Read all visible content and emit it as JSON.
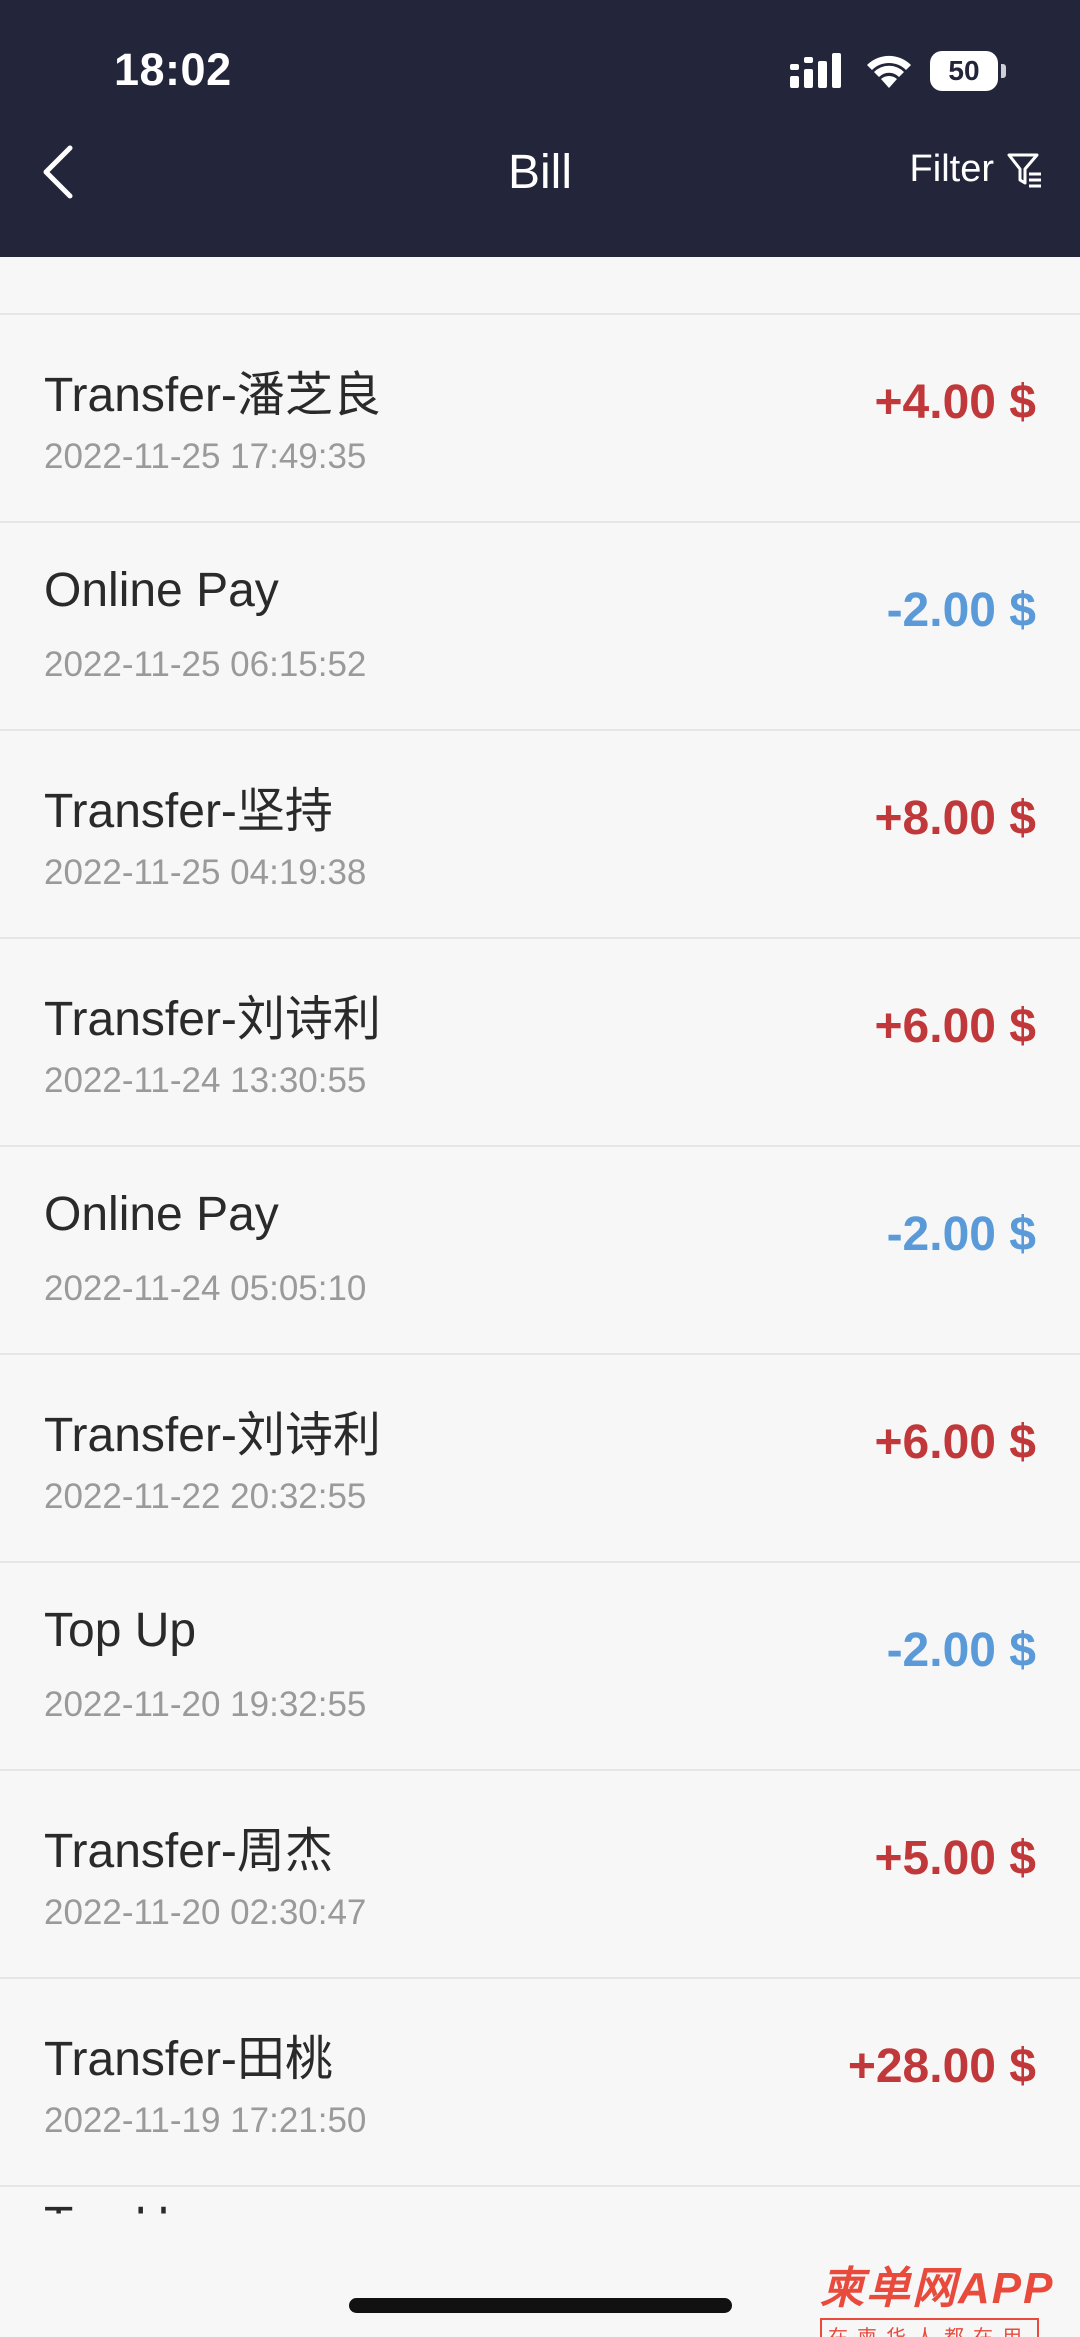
{
  "status_bar": {
    "time": "18:02",
    "battery": "50"
  },
  "header": {
    "title": "Bill",
    "filter_label": "Filter"
  },
  "transactions": [
    {
      "name": "Transfer-潘芝良",
      "time": "2022-11-25 17:49:35",
      "amount": "+4.00 $"
    },
    {
      "name": "Online Pay",
      "time": "2022-11-25 06:15:52",
      "amount": "-2.00 $"
    },
    {
      "name": "Transfer-坚持",
      "time": "2022-11-25 04:19:38",
      "amount": "+8.00 $"
    },
    {
      "name": "Transfer-刘诗利",
      "time": "2022-11-24 13:30:55",
      "amount": "+6.00 $"
    },
    {
      "name": "Online Pay",
      "time": "2022-11-24 05:05:10",
      "amount": "-2.00 $"
    },
    {
      "name": "Transfer-刘诗利",
      "time": "2022-11-22 20:32:55",
      "amount": "+6.00 $"
    },
    {
      "name": "Top Up",
      "time": "2022-11-20 19:32:55",
      "amount": "-2.00 $"
    },
    {
      "name": "Transfer-周杰",
      "time": "2022-11-20 02:30:47",
      "amount": "+5.00 $"
    },
    {
      "name": "Transfer-田桃",
      "time": "2022-11-19 17:21:50",
      "amount": "+28.00 $"
    }
  ],
  "partial_next_row": {
    "name": "Top Up"
  },
  "watermark": {
    "main": "柬单网APP",
    "sub": "在柬华人都在用"
  },
  "colors": {
    "header_bg": "#23253a",
    "income": "#c0383a",
    "expense": "#5a9ad8"
  }
}
